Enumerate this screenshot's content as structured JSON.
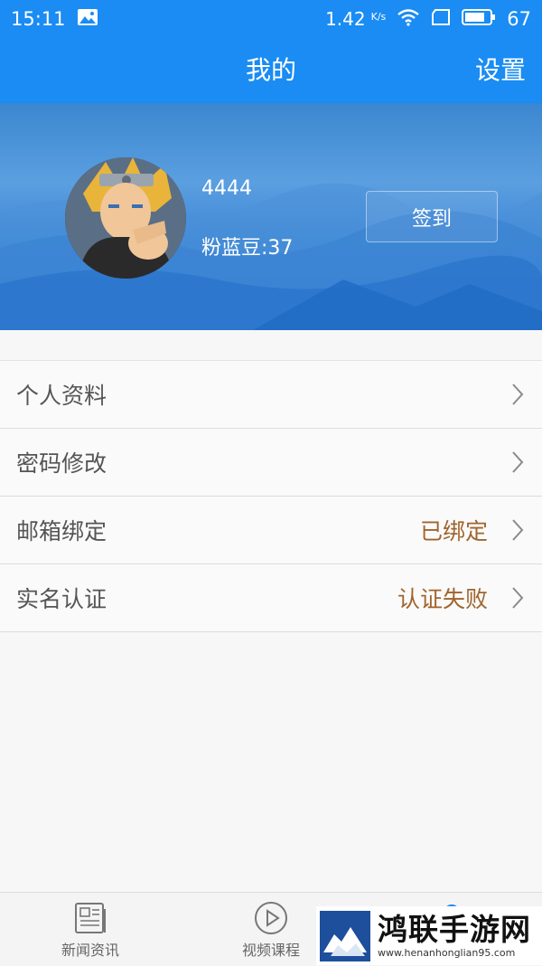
{
  "status_bar": {
    "time": "15:11",
    "net_speed": "1.42",
    "net_unit": "K/s",
    "battery": "67"
  },
  "header": {
    "title": "我的",
    "settings_label": "设置"
  },
  "profile": {
    "username": "4444",
    "beans": "粉蓝豆:37",
    "checkin_label": "签到"
  },
  "menu": [
    {
      "label": "个人资料",
      "value": ""
    },
    {
      "label": "密码修改",
      "value": ""
    },
    {
      "label": "邮箱绑定",
      "value": "已绑定"
    },
    {
      "label": "实名认证",
      "value": "认证失败"
    }
  ],
  "tabs": [
    {
      "label": "新闻资讯",
      "icon": "news-icon"
    },
    {
      "label": "视频课程",
      "icon": "play-icon"
    },
    {
      "label": "",
      "icon": "profile-icon"
    }
  ],
  "watermark": {
    "name": "鸿联手游网",
    "url": "www.henanhonglian95.com"
  },
  "colors": {
    "primary": "#1a8cf3",
    "status_value": "#a0642d"
  }
}
